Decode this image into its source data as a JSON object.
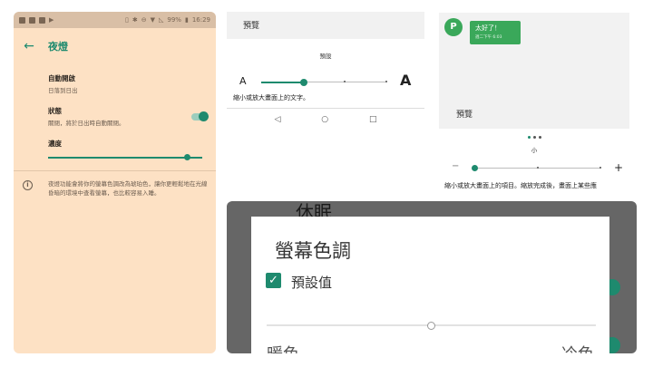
{
  "night_light": {
    "status_bar": {
      "battery": "99%",
      "time": "16:29"
    },
    "title": "夜燈",
    "auto_on": {
      "title": "自動開啟",
      "subtitle": "日落到日出"
    },
    "status": {
      "title": "狀態",
      "subtitle": "關閉，將於日出時自動關閉。",
      "on": true
    },
    "intensity": {
      "title": "濃度",
      "level": 0.9
    },
    "info": "夜燈功能會將你的螢幕色調改為琥珀色，讓你更輕鬆地在光線昏暗的環境中查看螢幕，也比較容易入睡。"
  },
  "font_size": {
    "header": "預覽",
    "current": "預設",
    "small_label": "A",
    "large_label": "A",
    "caption": "縮小或放大畫面上的文字。",
    "level_index": 1,
    "level_count": 4
  },
  "display_size": {
    "avatar_letter": "P",
    "message": "太好了！",
    "message_time": "週二下午 6:03",
    "header": "預覽",
    "current": "小",
    "minus": "−",
    "plus": "+",
    "caption": "縮小或放大畫面上的項目。縮放完成後，畫面上某些應",
    "level_index": 0,
    "level_count": 4
  },
  "screen_color": {
    "background_title": "休眠",
    "title": "螢幕色調",
    "default_label": "預設值",
    "default_checked": true,
    "warm_label": "暖色",
    "cool_label": "冷色",
    "temperature": 0.5
  },
  "colors": {
    "accent": "#1e8a6e",
    "bubble": "#3aa85a",
    "night_bg": "#fde1c4"
  }
}
